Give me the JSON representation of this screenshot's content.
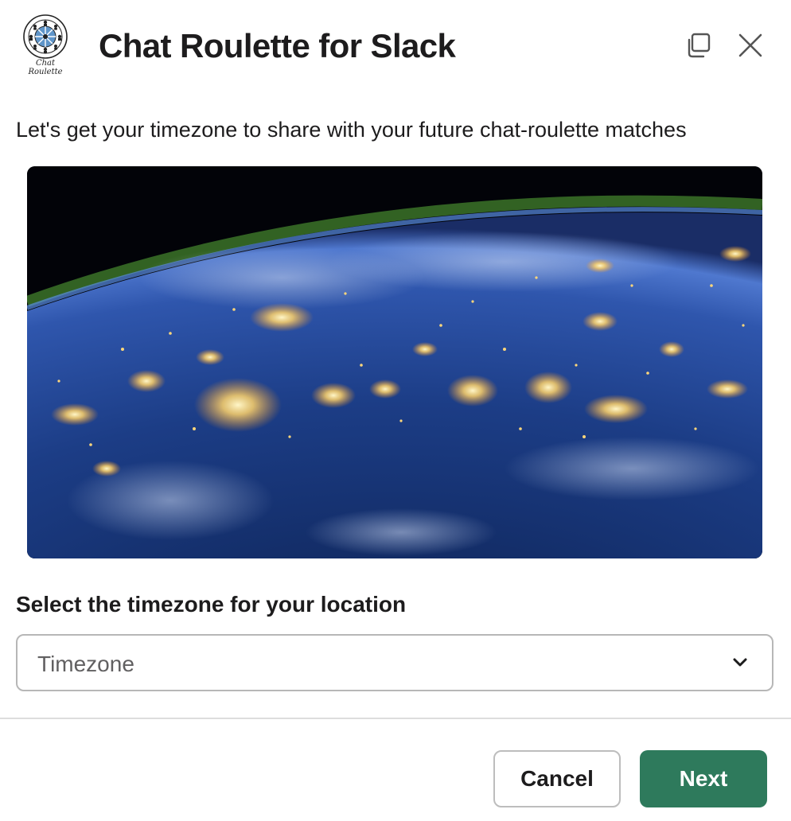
{
  "header": {
    "title": "Chat Roulette for Slack",
    "logo_caption": "Chat Roulette",
    "logo_icon": "roulette-wheel-logo",
    "popout_icon": "popout-icon",
    "close_icon": "close-icon"
  },
  "body": {
    "intro": "Let's get your timezone to share with your future chat-roulette matches",
    "image_subject": "earth-at-night-photo",
    "field_label": "Select the timezone for your location",
    "select": {
      "placeholder": "Timezone",
      "icon": "chevron-down-icon"
    }
  },
  "footer": {
    "cancel_label": "Cancel",
    "next_label": "Next"
  },
  "colors": {
    "primary_button": "#2e7a5c",
    "text": "#1d1c1d",
    "border": "#b7b7b7"
  }
}
